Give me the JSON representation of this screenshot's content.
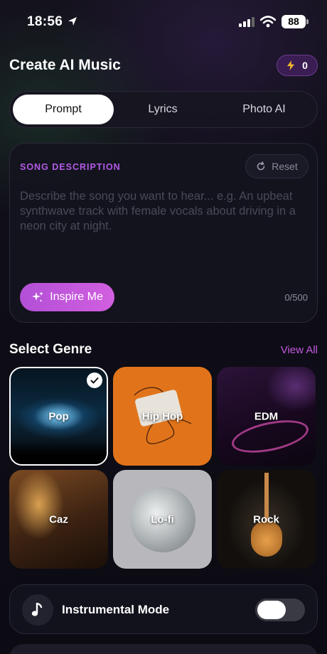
{
  "status_bar": {
    "time": "18:56",
    "battery": "88"
  },
  "header": {
    "title": "Create AI Music",
    "credits": "0",
    "credits_icon": "lightning-bolt-icon"
  },
  "tabs": [
    {
      "label": "Prompt",
      "active": true
    },
    {
      "label": "Lyrics",
      "active": false
    },
    {
      "label": "Photo AI",
      "active": false
    }
  ],
  "description": {
    "label": "SONG DESCRIPTION",
    "reset_label": "Reset",
    "placeholder": "Describe the song you want to hear... e.g. An upbeat synthwave track with female vocals about driving in a neon city at night.",
    "value": "",
    "inspire_label": "Inspire Me",
    "char_count": "0/500"
  },
  "genres": {
    "title": "Select Genre",
    "view_all": "View All",
    "items": [
      {
        "label": "Pop",
        "selected": true
      },
      {
        "label": "Hip Hop",
        "selected": false
      },
      {
        "label": "EDM",
        "selected": false
      },
      {
        "label": "Caz",
        "selected": false
      },
      {
        "label": "Lo-fi",
        "selected": false
      },
      {
        "label": "Rock",
        "selected": false
      }
    ]
  },
  "instrumental": {
    "label": "Instrumental Mode",
    "enabled": false
  },
  "colors": {
    "accent": "#c25ae0",
    "background": "#0c0b14",
    "card": "#14131e"
  }
}
